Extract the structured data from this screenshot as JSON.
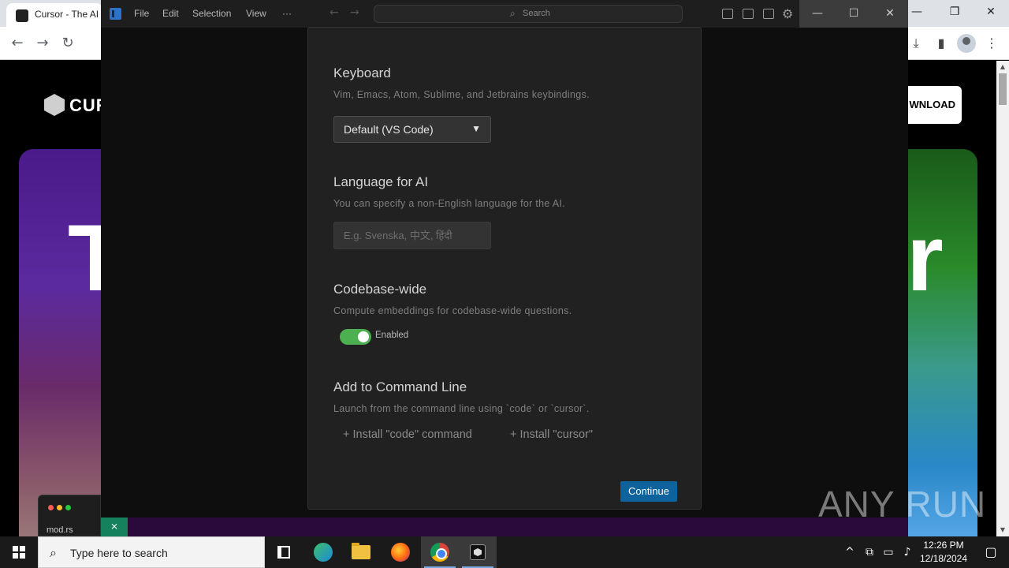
{
  "browser": {
    "tab_title": "Cursor - The AI",
    "page_logo_text": "CUR",
    "download_label": "WNLOAD",
    "hero_left_char": "T",
    "hero_right_char": "r",
    "code_card_file": "mod.rs"
  },
  "editor": {
    "menu": [
      "File",
      "Edit",
      "Selection",
      "View",
      "···"
    ],
    "search_placeholder": "Search",
    "window_controls": {
      "minimize": "—",
      "maximize": "☐",
      "close": "✕"
    }
  },
  "onboarding": {
    "keyboard": {
      "title": "Keyboard",
      "description": "Vim, Emacs, Atom, Sublime, and Jetbrains keybindings.",
      "selected": "Default (VS Code)"
    },
    "language": {
      "title": "Language for AI",
      "description": "You can specify a non-English language for the AI.",
      "placeholder": "E.g. Svenska, 中文, हिंदी",
      "value": ""
    },
    "codebase": {
      "title": "Codebase-wide",
      "description": "Compute embeddings for codebase-wide questions.",
      "toggle_label": "Enabled",
      "enabled": true
    },
    "command_line": {
      "title": "Add to Command Line",
      "description": "Launch from the command line using `code` or `cursor`.",
      "install_code": "+ Install \"code\" command",
      "install_cursor": "+ Install \"cursor\""
    },
    "continue_label": "Continue"
  },
  "watermark": "ANY RUN",
  "taskbar": {
    "search_placeholder": "Type here to search",
    "time": "12:26 PM",
    "date": "12/18/2024"
  },
  "colors": {
    "accent": "#0e639c",
    "toggle_on": "#4caf50",
    "modal_bg": "#212121"
  }
}
